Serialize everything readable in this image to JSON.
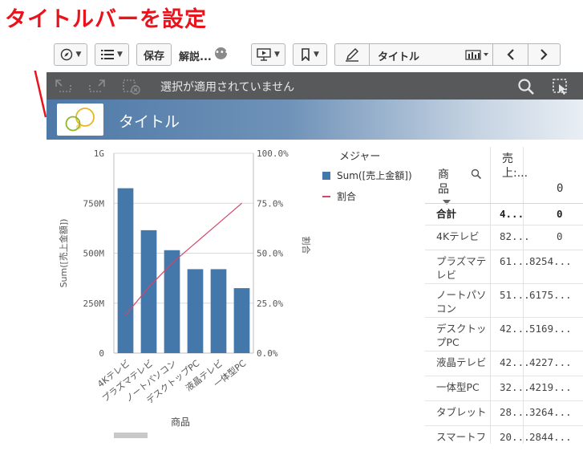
{
  "annotation": {
    "text": "タイトルバーを設定",
    "color": "#e8131b"
  },
  "toolbar": {
    "save_label": "保存",
    "sheet_name": "解説...",
    "sheet_menu_glyph": "•••",
    "title_label": "タイトル",
    "icons": [
      "compass-icon",
      "list-icon",
      "present-icon",
      "bookmark-icon",
      "pencil-icon",
      "chart-type-icon",
      "chevron-left-icon",
      "chevron-right-icon"
    ]
  },
  "selection_bar": {
    "text": "選択が適用されていません"
  },
  "sheet_title": {
    "text": "タイトル"
  },
  "chart_data": {
    "type": "bar",
    "categories": [
      "4Kテレビ",
      "プラズマテレビ",
      "ノートパソコン",
      "デスクトップPC",
      "液晶テレビ",
      "一体型PC"
    ],
    "series": [
      {
        "name": "Sum([売上金額])",
        "type": "bar",
        "axis": "left",
        "values": [
          825000000,
          615000000,
          515000000,
          420000000,
          420000000,
          325000000
        ],
        "color": "#4477aa"
      },
      {
        "name": "割合",
        "type": "line",
        "axis": "right",
        "values": [
          0.19,
          0.33,
          0.45,
          0.55,
          0.65,
          0.75
        ],
        "color": "#d1486a"
      }
    ],
    "xlabel": "商品",
    "ylabel": "Sum([売上金額])",
    "y2label": "割合",
    "ylim": [
      0,
      1000000000
    ],
    "y2lim": [
      0,
      1
    ],
    "yticks": [
      0,
      250000000,
      500000000,
      750000000,
      1000000000
    ],
    "ytick_labels": [
      "0",
      "250M",
      "500M",
      "750M",
      "1G"
    ],
    "y2ticks": [
      0,
      0.25,
      0.5,
      0.75,
      1
    ],
    "y2tick_labels": [
      "0.0%",
      "25.0%",
      "50.0%",
      "75.0%",
      "100.0%"
    ],
    "grid": true,
    "legend": {
      "title": "メジャー",
      "placement": "right"
    }
  },
  "table": {
    "headers": {
      "product": "商品",
      "sales": "売上:...",
      "third": "0"
    },
    "total": {
      "label": "合計",
      "sales": "4...",
      "third": "0"
    },
    "rows": [
      {
        "product": "4Kテレビ",
        "sales": "82...",
        "third": "0"
      },
      {
        "product": "プラズマテレビ",
        "sales": "61...",
        "third": "8254..."
      },
      {
        "product": "ノートパソコン",
        "sales": "51...",
        "third": "6175..."
      },
      {
        "product": "デスクトップPC",
        "sales": "42...",
        "third": "5169..."
      },
      {
        "product": "液晶テレビ",
        "sales": "42...",
        "third": "4227..."
      },
      {
        "product": "一体型PC",
        "sales": "32...",
        "third": "4219..."
      },
      {
        "product": "タブレット",
        "sales": "28...",
        "third": "3264..."
      },
      {
        "product": "スマートフ",
        "sales": "20...",
        "third": "2844..."
      }
    ]
  }
}
